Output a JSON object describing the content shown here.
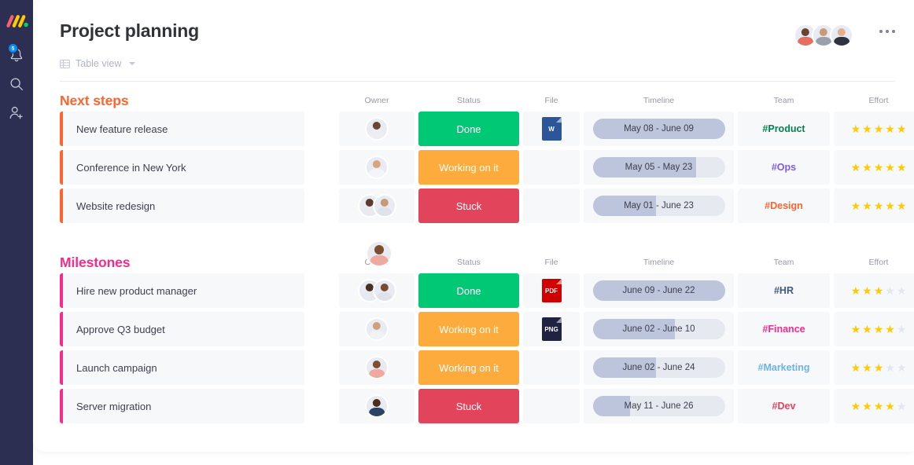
{
  "sidebar": {
    "logo_name": "monday-logo",
    "items": [
      {
        "name": "notifications-icon",
        "badge": "5"
      },
      {
        "name": "search-icon",
        "badge": ""
      },
      {
        "name": "invite-member-icon",
        "badge": ""
      }
    ]
  },
  "header": {
    "title": "Project planning",
    "view_label": "Table view",
    "view_icon": "table-icon",
    "more_menu": "more-options-icon",
    "member_avatars": [
      {
        "skin": "#6a4230",
        "shirt": "#e5705f"
      },
      {
        "skin": "#c79b79",
        "shirt": "#9aa1ad"
      },
      {
        "skin": "#e0b08f",
        "shirt": "#2f3240"
      }
    ]
  },
  "columns": [
    "Owner",
    "Status",
    "File",
    "Timeline",
    "Team",
    "Effort"
  ],
  "colors": {
    "done": "#00c875",
    "working": "#fdab3d",
    "stuck": "#e2445c",
    "next_steps_accent": "#ff642e",
    "milestones_accent": "#f62b8a",
    "star_on": "#ffcb00",
    "star_off": "#e3e6ee",
    "timeline_track": "#e6e9f0",
    "timeline_fill": "#bcc5db"
  },
  "groups": [
    {
      "title": "Next steps",
      "accent": "#ff642e",
      "rows": [
        {
          "name": "New feature release",
          "status": "Done",
          "status_color": "#00c875",
          "file": {
            "label": "W",
            "color": "#2b579a",
            "icon": "word-file-icon"
          },
          "timeline": "May 08 - June 09",
          "progress": 100,
          "team": "#Product",
          "team_color": "#00854d",
          "effort": 5,
          "owners": [
            {
              "skin": "#6b4432",
              "shirt": "#eceef3"
            }
          ]
        },
        {
          "name": "Conference in New York",
          "status": "Working on it",
          "status_color": "#fdab3d",
          "file": null,
          "timeline": "May 05 - May 23",
          "progress": 78,
          "team": "#Ops",
          "team_color": "#7e5ce0",
          "effort": 5,
          "owners": [
            {
              "skin": "#d9a57e",
              "shirt": "#f4f5f8"
            }
          ]
        },
        {
          "name": "Website redesign",
          "status": "Stuck",
          "status_color": "#e2445c",
          "file": null,
          "timeline": "May 01 - June 23",
          "progress": 48,
          "team": "#Design",
          "team_color": "#ff642e",
          "effort": 5,
          "owners": [
            {
              "skin": "#5d3b2a",
              "shirt": "#e8eaf0"
            },
            {
              "skin": "#c79a78",
              "shirt": "#dfe2ea"
            }
          ]
        }
      ]
    },
    {
      "title": "Milestones",
      "accent": "#f62b8a",
      "rows": [
        {
          "name": "Hire new product manager",
          "status": "Done",
          "status_color": "#00c875",
          "file": {
            "label": "PDF",
            "color": "#d10000",
            "icon": "pdf-file-icon"
          },
          "timeline": "June 09 - June 22",
          "progress": 100,
          "team": "#HR",
          "team_color": "#3d5a80",
          "effort": 3,
          "owners": [
            {
              "skin": "#4a2e20",
              "shirt": "#e7e9f0"
            },
            {
              "skin": "#7a4b32",
              "shirt": "#dfe2ea"
            }
          ]
        },
        {
          "name": "Approve Q3 budget",
          "status": "Working on it",
          "status_color": "#fdab3d",
          "file": {
            "label": "PNG",
            "color": "#1f2240",
            "icon": "png-file-icon"
          },
          "timeline": "June 02 - June 10",
          "progress": 62,
          "team": "#Finance",
          "team_color": "#f62b8a",
          "effort": 4,
          "owners": [
            {
              "skin": "#d0a07c",
              "shirt": "#f0f2f6"
            }
          ]
        },
        {
          "name": "Launch campaign",
          "status": "Working on it",
          "status_color": "#fdab3d",
          "file": null,
          "timeline": "June 02  - June 24",
          "progress": 48,
          "team": "#Marketing",
          "team_color": "#6ab3ed",
          "effort": 3,
          "owners": [
            {
              "skin": "#7d4e31",
              "shirt": "#f0a9a0"
            }
          ]
        },
        {
          "name": "Server migration",
          "status": "Stuck",
          "status_color": "#e2445c",
          "file": null,
          "timeline": "May 11 - June 26",
          "progress": 28,
          "team": "#Dev",
          "team_color": "#e2445c",
          "effort": 4,
          "owners": [
            {
              "skin": "#4b2d1e",
              "shirt": "#2d4466"
            }
          ]
        }
      ]
    }
  ],
  "floating_avatar": {
    "skin": "#7d4e31",
    "shirt": "#f0a9a0"
  }
}
